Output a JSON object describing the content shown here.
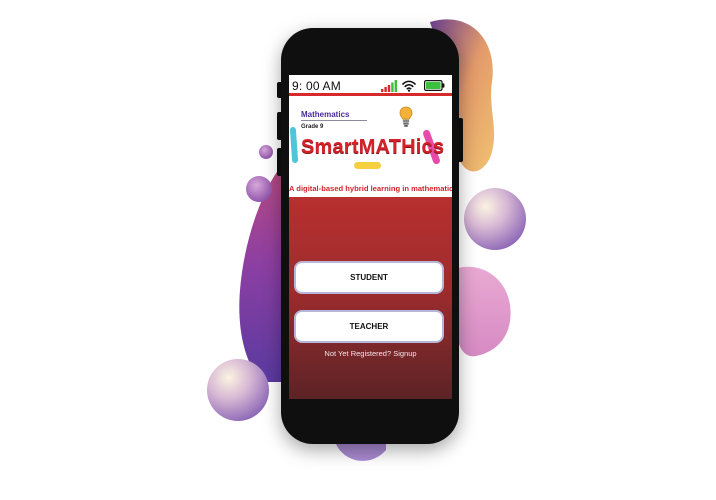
{
  "status_bar": {
    "time": "9: 00 AM",
    "icons": [
      "signal-icon",
      "wifi-icon",
      "battery-icon"
    ]
  },
  "header": {
    "subject": "Mathematics",
    "grade": "Grade 9",
    "title": "SmartMATHics",
    "tagline": "A digital-based hybrid learning in mathematics"
  },
  "buttons": {
    "student": "STUDENT",
    "teacher": "TEACHER"
  },
  "signup_link": "Not Yet Registered? Signup",
  "colors": {
    "accent_red": "#d4222a",
    "subject_purple": "#4a2c9a",
    "gradient_top": "#b82f2e",
    "gradient_bottom": "#5c2326",
    "signal_green": "#3cbf3c",
    "battery_green": "#3cbf3c"
  }
}
